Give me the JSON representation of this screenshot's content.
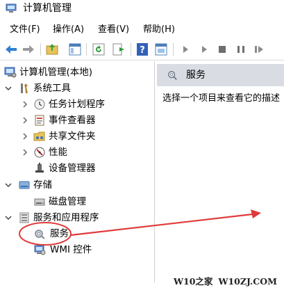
{
  "window": {
    "title": "计算机管理"
  },
  "menu": [
    {
      "label": "文件(F)"
    },
    {
      "label": "操作(A)"
    },
    {
      "label": "查看(V)"
    },
    {
      "label": "帮助(H)"
    }
  ],
  "toolbar": {
    "icons": [
      "back-arrow-icon",
      "forward-arrow-icon",
      "up-folder-icon",
      "show-hide-tree-icon",
      "refresh-icon",
      "export-list-icon",
      "help-icon",
      "properties-icon",
      "start-icon",
      "play-icon",
      "stop-icon",
      "pause-icon",
      "restart-icon"
    ]
  },
  "tree": {
    "root": {
      "label": "计算机管理(本地)"
    },
    "system_tools": {
      "label": "系统工具"
    },
    "task_scheduler": {
      "label": "任务计划程序"
    },
    "event_viewer": {
      "label": "事件查看器"
    },
    "shared_folders": {
      "label": "共享文件夹"
    },
    "performance": {
      "label": "性能"
    },
    "device_manager": {
      "label": "设备管理器"
    },
    "storage": {
      "label": "存储"
    },
    "disk_management": {
      "label": "磁盘管理"
    },
    "services_apps": {
      "label": "服务和应用程序"
    },
    "services": {
      "label": "服务"
    },
    "wmi": {
      "label": "WMI 控件"
    }
  },
  "content": {
    "header_title": "服务",
    "description": "选择一个项目来查看它的描述"
  },
  "watermark": {
    "left": "W10之家",
    "right": "W10ZJ.COM"
  },
  "colors": {
    "annotation_red": "#e03a3a",
    "header_bg": "#d9dde3"
  }
}
